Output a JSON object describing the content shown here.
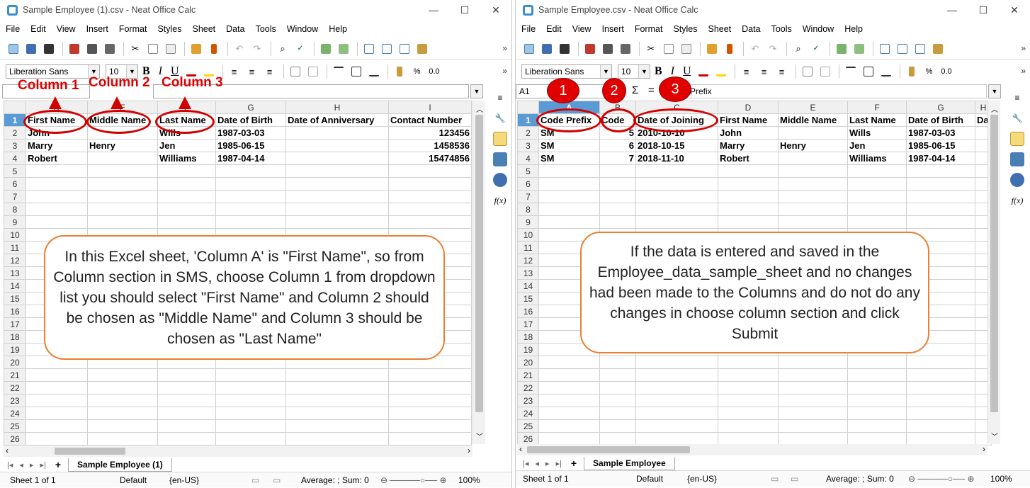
{
  "left": {
    "title": "Sample Employee (1).csv - Neat Office Calc",
    "menu": [
      "File",
      "Edit",
      "View",
      "Insert",
      "Format",
      "Styles",
      "Sheet",
      "Data",
      "Tools",
      "Window",
      "Help"
    ],
    "font_name": "Liberation Sans",
    "font_size": "10",
    "percent": "%",
    "decimal": "0.0",
    "columns": [
      "D",
      "E",
      "F",
      "G",
      "H",
      "I"
    ],
    "rows": [
      [
        "First Name",
        "Middle Name",
        "Last Name",
        "Date of Birth",
        "Date of Anniversary",
        "Contact Number"
      ],
      [
        "John",
        "",
        "Wills",
        "1987-03-03",
        "",
        "123456"
      ],
      [
        "Marry",
        "Henry",
        "Jen",
        "1985-06-15",
        "",
        "1458536"
      ],
      [
        "Robert",
        "",
        "Williams",
        "1987-04-14",
        "",
        "15474856"
      ]
    ],
    "row_numbers": [
      "1",
      "2",
      "3",
      "4",
      "5",
      "6",
      "7",
      "8",
      "9",
      "10",
      "11",
      "12",
      "13",
      "14",
      "15",
      "16",
      "17",
      "18",
      "19",
      "20",
      "21",
      "22",
      "23",
      "24",
      "25",
      "26"
    ],
    "sheet_tab": "Sample Employee (1)",
    "status": {
      "sheet": "Sheet 1 of 1",
      "style": "Default",
      "lang": "{en-US}",
      "calc": "Average: ; Sum: 0",
      "zoom": "100%"
    },
    "annotations": {
      "col1": "Column 1",
      "col2": "Column 2",
      "col3": "Column 3"
    },
    "callout": "In this Excel sheet, 'Column A' is \"First Name\", so from Column section in SMS, choose Column 1 from dropdown list you should select \"First Name\" and Column 2 should be chosen as \"Middle Name\" and Column 3 should be chosen as \"Last Name\""
  },
  "right": {
    "title": "Sample Employee.csv - Neat Office Calc",
    "menu": [
      "File",
      "Edit",
      "View",
      "Insert",
      "Format",
      "Styles",
      "Sheet",
      "Data",
      "Tools",
      "Window",
      "Help"
    ],
    "font_name": "Liberation Sans",
    "font_size": "10",
    "percent": "%",
    "decimal": "0.0",
    "name_box": "A1",
    "sigma": "Σ",
    "equals": "=",
    "formula_value": "Prefix",
    "columns": [
      "A",
      "B",
      "C",
      "D",
      "E",
      "F",
      "G",
      "H"
    ],
    "rows": [
      [
        "Code Prefix",
        "Code",
        "Date of Joining",
        "First Name",
        "Middle Name",
        "Last Name",
        "Date of Birth",
        "Da"
      ],
      [
        "SM",
        "5",
        "2010-10-10",
        "John",
        "",
        "Wills",
        "1987-03-03",
        ""
      ],
      [
        "SM",
        "6",
        "2018-10-15",
        "Marry",
        "Henry",
        "Jen",
        "1985-06-15",
        ""
      ],
      [
        "SM",
        "7",
        "2018-11-10",
        "Robert",
        "",
        "Williams",
        "1987-04-14",
        ""
      ]
    ],
    "row_numbers": [
      "1",
      "2",
      "3",
      "4",
      "5",
      "6",
      "7",
      "8",
      "9",
      "10",
      "11",
      "12",
      "13",
      "14",
      "15",
      "16",
      "17",
      "18",
      "19",
      "20",
      "21",
      "22",
      "23",
      "24",
      "25",
      "26"
    ],
    "sheet_tab": "Sample Employee",
    "status": {
      "sheet": "Sheet 1 of 1",
      "style": "Default",
      "lang": "{en-US}",
      "calc": "Average: ; Sum: 0",
      "zoom": "100%"
    },
    "badges": [
      "1",
      "2",
      "3"
    ],
    "callout": "If the data is entered and saved in the Employee_data_sample_sheet and no changes had been made to the Columns and do not do any changes in choose column section and click Submit"
  },
  "colors": {
    "annotation_red": "#d30000",
    "callout_orange": "#ed7d31",
    "selected_header": "#5b9bd5"
  }
}
